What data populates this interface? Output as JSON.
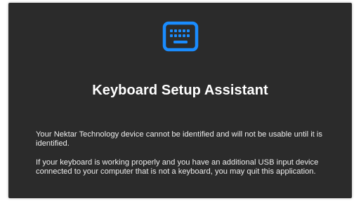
{
  "window": {
    "icon": "keyboard-icon",
    "accent_color": "#1a8cff",
    "title": "Keyboard Setup Assistant",
    "messages": [
      "Your Nektar Technology device cannot be identified and will not be usable until it is identified.",
      "If your keyboard is working properly and you have an additional USB input device connected to your computer that is not a keyboard, you may quit this application."
    ]
  }
}
